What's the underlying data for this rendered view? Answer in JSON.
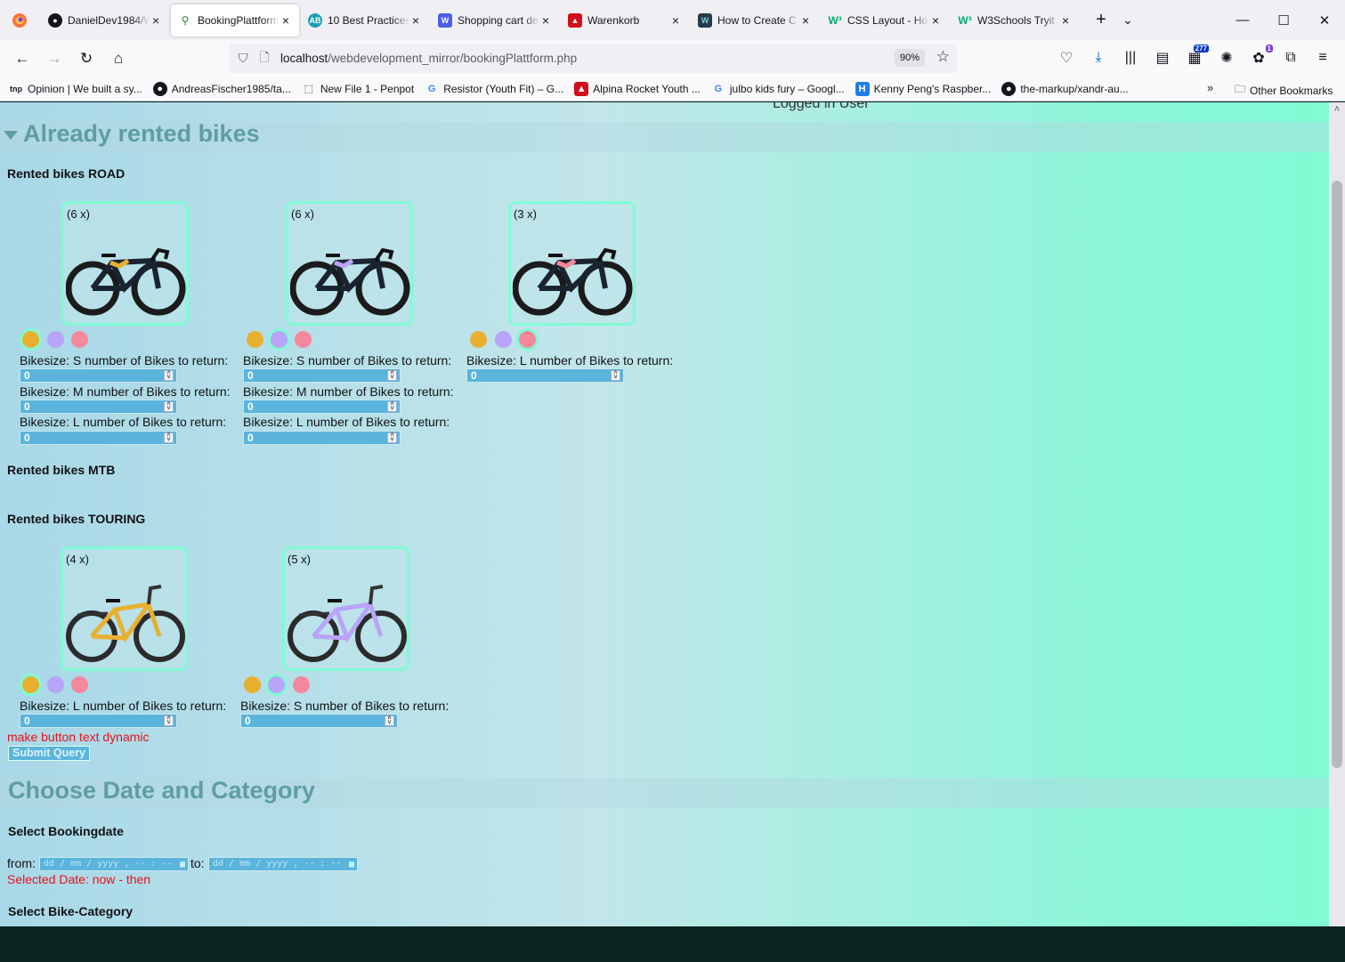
{
  "browser": {
    "tabs": [
      {
        "label": "DanielDev1984/W",
        "icon": "github-icon",
        "active": false
      },
      {
        "label": "BookingPlattform",
        "icon": "bike-icon",
        "active": true
      },
      {
        "label": "10 Best Practices",
        "icon": "ab-icon",
        "active": false
      },
      {
        "label": "Shopping cart de",
        "icon": "w-blue-icon",
        "active": false
      },
      {
        "label": "Warenkorb",
        "icon": "mountain-red-icon",
        "active": false
      },
      {
        "label": "How to Create C",
        "icon": "wd-icon",
        "active": false
      },
      {
        "label": "CSS Layout - Ho",
        "icon": "w3schools-icon",
        "active": false
      },
      {
        "label": "W3Schools Tryit",
        "icon": "w3schools-icon",
        "active": false
      }
    ],
    "url_host": "localhost",
    "url_path": "/webdevelopment_mirror/bookingPlattform.php",
    "zoom": "90%",
    "badge_count": "277",
    "badge_ext": "1",
    "bookmarks": [
      {
        "label": "Opinion | We built a sy...",
        "icon": "tnp-icon"
      },
      {
        "label": "AndreasFischer1985/ta...",
        "icon": "github-icon"
      },
      {
        "label": "New File 1 - Penpot",
        "icon": "penpot-icon"
      },
      {
        "label": "Resistor (Youth Fit) – G...",
        "icon": "google-icon"
      },
      {
        "label": "Alpina Rocket Youth ...",
        "icon": "alpina-icon"
      },
      {
        "label": "julbo kids fury – Googl...",
        "icon": "google-icon"
      },
      {
        "label": "Kenny Peng's Raspber...",
        "icon": "kp-icon"
      },
      {
        "label": "the-markup/xandr-au...",
        "icon": "github-icon"
      }
    ],
    "other_bookmarks": "Other Bookmarks"
  },
  "page": {
    "peek_text": "Logged in User",
    "rented_title": "Already rented bikes",
    "road_heading": "Rented bikes ROAD",
    "mtb_heading": "Rented bikes MTB",
    "touring_heading": "Rented bikes TOURING",
    "road_cards": [
      {
        "qty": "(6 x)",
        "accent": "#e8b030"
      },
      {
        "qty": "(6 x)",
        "accent": "#b8a4f8"
      },
      {
        "qty": "(3 x)",
        "accent": "#f4889c"
      }
    ],
    "touring_cards": [
      {
        "qty": "(4 x)",
        "accent": "#e8b030"
      },
      {
        "qty": "(5 x)",
        "accent": "#b8a4f8"
      }
    ],
    "colors": {
      "orange": "#e8b030",
      "lilac": "#b8a4f8",
      "pink": "#f4889c"
    },
    "size_labels": {
      "s": "Bikesize: S number of Bikes to return:",
      "m": "Bikesize: M number of Bikes to return:",
      "l": "Bikesize: L number of Bikes to return:"
    },
    "qty_value": "0",
    "dynamic_note": "make button text dynamic",
    "submit_label": "Submit Query",
    "choose_title": "Choose Date and Category",
    "bookingdate_heading": "Select Bookingdate",
    "from_label": "from:",
    "to_label": "to:",
    "date_placeholder": "dd / mm / yyyy ,  -- : --",
    "selected_date": "Selected Date: now - then",
    "category_heading": "Select Bike-Category"
  }
}
